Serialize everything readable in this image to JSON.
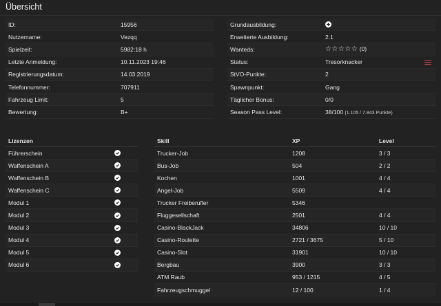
{
  "title": "Übersicht",
  "info_left": [
    {
      "label": "ID:",
      "value": "15956"
    },
    {
      "label": "Nutzername:",
      "value": "Vezqq"
    },
    {
      "label": "Spielzeit:",
      "value": "5982:18 h"
    },
    {
      "label": "Letzte Anmeldung:",
      "value": "10.11.2023 19:46"
    },
    {
      "label": "Registrierungsdatum:",
      "value": "14.03.2019"
    },
    {
      "label": "Telefonnummer:",
      "value": "707911"
    },
    {
      "label": "Fahrzeug Limit:",
      "value": "5"
    },
    {
      "label": "Bewertung:",
      "value": "B+"
    }
  ],
  "info_right": {
    "grundausbildung_label": "Grundausbildung:",
    "grundausbildung_icon": "plus-circle-icon",
    "erweiterte_label": "Erweiterte Ausbildung:",
    "erweiterte_value": "2.1",
    "wanteds_label": "Wanteds:",
    "wanteds_stars": "☆☆☆☆☆",
    "wanteds_count": "(0)",
    "status_label": "Status:",
    "status_value": "Tresorknacker",
    "status_icon": "list-icon",
    "status_icon_color": "#d64545",
    "stvo_label": "StVO-Punkte:",
    "stvo_value": "2",
    "spawn_label": "Spawnpunkt:",
    "spawn_value": "Gang",
    "bonus_label": "Täglicher Bonus:",
    "bonus_value": "0/0",
    "season_label": "Season Pass Level:",
    "season_value": "38/100",
    "season_points": "(1.105 / 7.843 Punkte)"
  },
  "licenses": {
    "header": "Lizenzen",
    "items": [
      "Führerschein",
      "Waffenschein A",
      "Waffenschein B",
      "Waffenschein C",
      "Modul 1",
      "Modul 2",
      "Modul 3",
      "Modul 4",
      "Modul 5",
      "Modul 6"
    ]
  },
  "skills": {
    "headers": {
      "skill": "Skill",
      "xp": "XP",
      "level": "Level"
    },
    "rows": [
      {
        "skill": "Trucker-Job",
        "xp": "1208",
        "level": "3 / 3"
      },
      {
        "skill": "Bus-Job",
        "xp": "504",
        "level": "2 / 2"
      },
      {
        "skill": "Kochen",
        "xp": "1001",
        "level": "4 / 4"
      },
      {
        "skill": "Angel-Job",
        "xp": "5509",
        "level": "4 / 4"
      },
      {
        "skill": "Trucker Freiberufler",
        "xp": "5346",
        "level": ""
      },
      {
        "skill": "Fluggesellschaft",
        "xp": "2501",
        "level": "4 / 4"
      },
      {
        "skill": "Casino-BlackJack",
        "xp": "34806",
        "level": "10 / 10"
      },
      {
        "skill": "Casino-Roulette",
        "xp": "2721 / 3675",
        "level": "5 / 10"
      },
      {
        "skill": "Casino-Slot",
        "xp": "31901",
        "level": "10 / 10"
      },
      {
        "skill": "Bergbau",
        "xp": "3900",
        "level": "3 / 3"
      },
      {
        "skill": "ATM Raub",
        "xp": "953 / 1215",
        "level": "4 / 5"
      },
      {
        "skill": "Fahrzeugschmuggel",
        "xp": "12 / 100",
        "level": "1 / 4"
      }
    ]
  }
}
